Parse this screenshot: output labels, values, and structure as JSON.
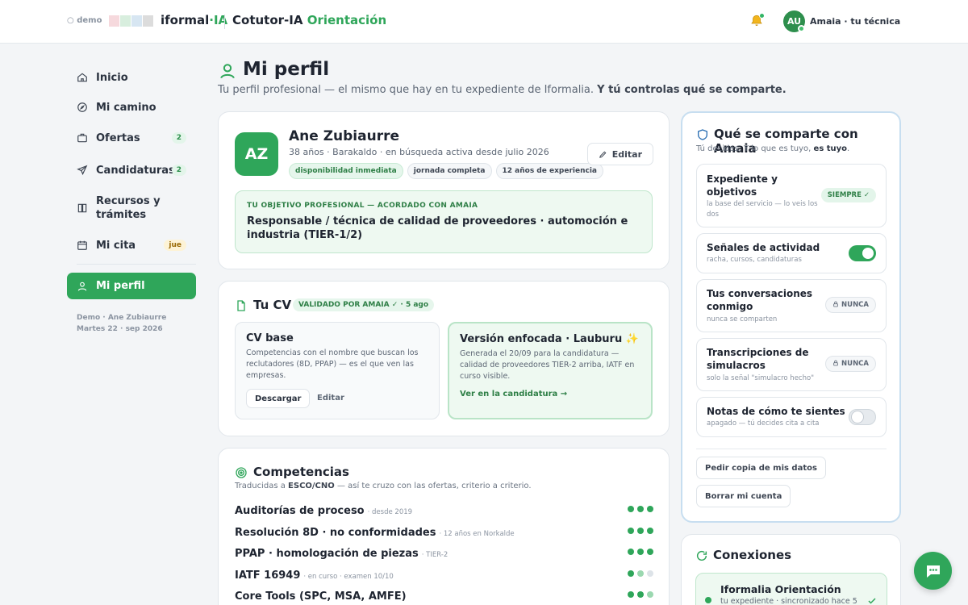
{
  "topbar": {
    "demo_label": "○ demo",
    "brand_main": "iformal",
    "brand_accent": "·IA",
    "product_main": "Cotutor-IA",
    "product_accent": "Orientación",
    "user_initials": "AU",
    "user_label": "Amaia · tu técnica",
    "swatch_colors": [
      "#f6d9dd",
      "#d8eede",
      "#d7e6f2",
      "#dcdcdc"
    ]
  },
  "sidebar": {
    "items": [
      {
        "label": "Inicio",
        "icon": "home-icon"
      },
      {
        "label": "Mi camino",
        "icon": "compass-icon"
      },
      {
        "label": "Ofertas",
        "icon": "briefcase-icon",
        "badge": "2"
      },
      {
        "label": "Candidaturas",
        "icon": "send-icon",
        "badge": "2"
      },
      {
        "label": "Recursos y trámites",
        "icon": "book-icon"
      },
      {
        "label": "Mi cita",
        "icon": "calendar-icon",
        "badge": "jue"
      },
      {
        "label": "Mi perfil",
        "icon": "user-icon",
        "active": true
      }
    ],
    "footer_line1": "Demo · Ane Zubiaurre",
    "footer_line2": "Martes 22 · sep 2026"
  },
  "page": {
    "title": "Mi perfil",
    "subtitle": "Tu perfil profesional — el mismo que hay en tu expediente de Iformalia.",
    "subtitle_bold": "Y tú controlas qué se comparte."
  },
  "profile": {
    "initials": "AZ",
    "name": "Ane Zubiaurre",
    "meta": "38 años · Barakaldo · en búsqueda activa desde julio 2026",
    "chips": [
      "disponibilidad inmediata",
      "jornada completa",
      "12 años de experiencia"
    ],
    "edit_label": "Editar",
    "goal_label": "TU OBJETIVO PROFESIONAL — ACORDADO CON AMAIA",
    "goal_text": "Responsable / técnica de calidad de proveedores · automoción e industria (TIER-1/2)"
  },
  "cv": {
    "title": "Tu CV",
    "badge": "VALIDADO POR AMAIA ✓ · 5 ago",
    "base_title": "CV base",
    "base_desc": "Competencias con el nombre que buscan los reclutadores (8D, PPAP) — es el que ven las empresas.",
    "download_label": "Descargar",
    "edit_label": "Editar",
    "focus_title": "Versión enfocada · Lauburu ✨",
    "focus_desc": "Generada el 20/09 para la candidatura — calidad de proveedores TIER-2 arriba, IATF en curso visible.",
    "focus_link": "Ver en la candidatura →"
  },
  "competencias": {
    "title": "Competencias",
    "subtitle_pre": "Traducidas a",
    "subtitle_bold": "ESCO/CNO",
    "subtitle_post": "— así te cruzo con las ofertas, criterio a criterio.",
    "items": [
      {
        "name": "Auditorías de proceso",
        "note": "· desde 2019",
        "level": 3
      },
      {
        "name": "Resolución 8D · no conformidades",
        "note": "· 12 años en Norkalde",
        "level": 3
      },
      {
        "name": "PPAP · homologación de piezas",
        "note": "· TIER-2",
        "level": 3
      },
      {
        "name": "IATF 16949",
        "note": "· en curso · examen 10/10",
        "level": 1.5
      },
      {
        "name": "Core Tools (SPC, MSA, AMFE)",
        "note": "",
        "level": 2.5
      }
    ]
  },
  "sharing": {
    "title": "Qué se comparte con Amaia",
    "subtitle_pre": "Tú decides. Y lo que es tuyo,",
    "subtitle_bold": "es tuyo",
    "subtitle_post": ".",
    "items": [
      {
        "title": "Expediente y objetivos",
        "desc": "la base del servicio — lo veis los dos",
        "control": "pill",
        "value": "SIEMPRE ✓"
      },
      {
        "title": "Señales de actividad",
        "desc": "racha, cursos, candidaturas",
        "control": "toggle",
        "on": true
      },
      {
        "title": "Tus conversaciones conmigo",
        "desc": "nunca se comparten",
        "control": "pill",
        "value": "NUNCA"
      },
      {
        "title": "Transcripciones de simulacros",
        "desc": "solo la señal \"simulacro hecho\"",
        "control": "pill",
        "value": "NUNCA"
      },
      {
        "title": "Notas de cómo te sientes",
        "desc": "apagado — tú decides cita a cita",
        "control": "toggle",
        "on": false
      }
    ],
    "copy_label": "Pedir copia de mis datos",
    "delete_label": "Borrar mi cuenta"
  },
  "conexiones": {
    "title": "Conexiones",
    "item_name": "Iformalia Orientación",
    "item_sub": "tu expediente · sincronizado hace 5"
  },
  "colors": {
    "accent": "#2fa65a",
    "accent_dark": "#2e8f4d"
  }
}
